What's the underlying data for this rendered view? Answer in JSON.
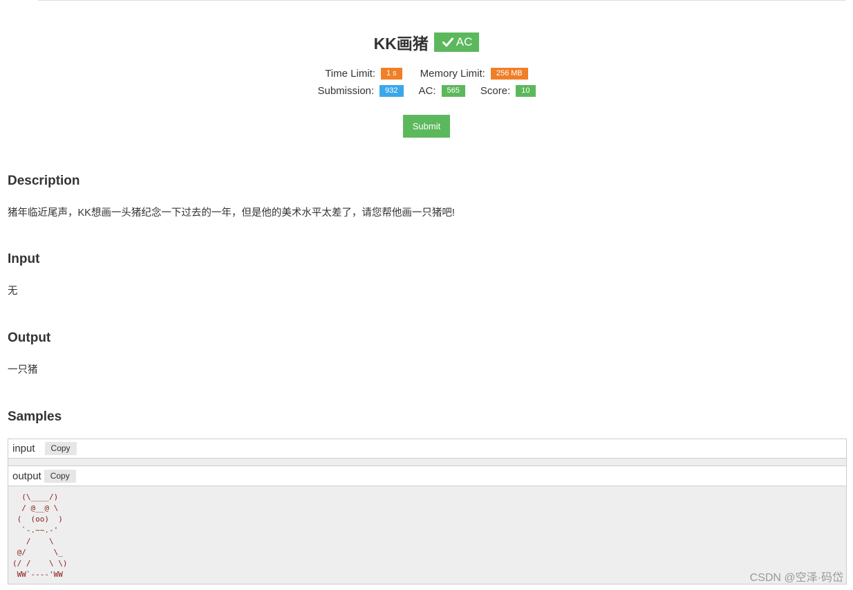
{
  "problem": {
    "title": "KK画猪",
    "status": "AC",
    "time_limit_label": "Time Limit:",
    "time_limit_value": "1 s",
    "memory_limit_label": "Memory Limit:",
    "memory_limit_value": "256 MB",
    "submission_label": "Submission:",
    "submission_value": "932",
    "ac_label": "AC:",
    "ac_value": "565",
    "score_label": "Score:",
    "score_value": "10",
    "submit_label": "Submit"
  },
  "sections": {
    "description_heading": "Description",
    "description_text": "猪年临近尾声，KK想画一头猪纪念一下过去的一年，但是他的美术水平太差了，请您帮他画一只猪吧!",
    "input_heading": "Input",
    "input_text": "无",
    "output_heading": "Output",
    "output_text": "一只猪",
    "samples_heading": "Samples"
  },
  "samples": {
    "input_label": "input",
    "output_label": "output",
    "copy_label": "Copy",
    "input_value": "",
    "output_value": "  (\\____/)\n  / @__@ \\\n (  (oo)  )\n  `-.~~.-'\n   /    \\\n @/      \\_\n(/ /    \\ \\)\n WW`----'WW"
  },
  "watermark": "CSDN @空泽·码岱",
  "colors": {
    "green": "#5cb85c",
    "orange": "#f07f28",
    "blue": "#3aa7eb",
    "ascii_text": "#8b1a1a"
  }
}
